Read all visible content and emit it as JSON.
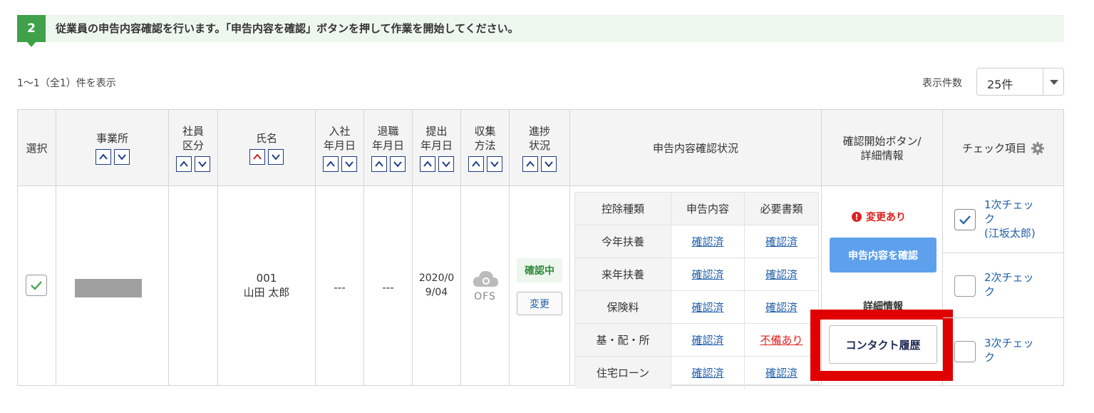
{
  "banner": {
    "step": "2",
    "text": "従業員の申告内容確認を行います。「申告内容を確認」ボタンを押して作業を開始してください。"
  },
  "list": {
    "count_text": "1〜1（全1）件を表示",
    "per_page_label": "表示件数",
    "per_page_value": "25件"
  },
  "columns": {
    "select": "選択",
    "office": "事業所",
    "emp_type_1": "社員",
    "emp_type_2": "区分",
    "name": "氏名",
    "join_1": "入社",
    "join_2": "年月日",
    "leave_1": "退職",
    "leave_2": "年月日",
    "submit_1": "提出",
    "submit_2": "年月日",
    "collect_1": "収集",
    "collect_2": "方法",
    "progress_1": "進捗",
    "progress_2": "状況",
    "status": "申告内容確認状況",
    "confirm_1": "確認開始ボタン/",
    "confirm_2": "詳細情報",
    "check_items": "チェック項目"
  },
  "row": {
    "emp_no": "001",
    "name": "山田 太郎",
    "join_date": "---",
    "leave_date": "---",
    "submit_date_1": "2020/0",
    "submit_date_2": "9/04",
    "collect_method": "OFS",
    "progress_badge": "確認中",
    "change_button": "変更"
  },
  "status_table": {
    "headers": [
      "控除種類",
      "申告内容",
      "必要書類"
    ],
    "rows": [
      {
        "kind": "今年扶養",
        "content": "確認済",
        "docs": "確認済"
      },
      {
        "kind": "来年扶養",
        "content": "確認済",
        "docs": "確認済"
      },
      {
        "kind": "保険料",
        "content": "確認済",
        "docs": "確認済"
      },
      {
        "kind": "基・配・所",
        "content": "確認済",
        "docs": "不備あり"
      },
      {
        "kind": "住宅ローン",
        "content": "確認済",
        "docs": "確認済"
      }
    ]
  },
  "confirm": {
    "changed_label": "変更あり",
    "start_button": "申告内容を確認",
    "detail_label": "詳細情報",
    "contact_button": "コンタクト履歴"
  },
  "checks": {
    "first_1": "1次チェッ",
    "first_2": "ク",
    "first_3": "(江坂太郎)",
    "second_1": "2次チェッ",
    "second_2": "ク",
    "third_1": "3次チェッ",
    "third_2": "ク"
  },
  "colors": {
    "step_green": "#3fa14a",
    "banner_bg": "#eef7ee",
    "link_blue": "#1f5fa8",
    "alert_red": "#e02020",
    "primary_button": "#5ea0ec",
    "highlight_frame": "#e00000"
  }
}
